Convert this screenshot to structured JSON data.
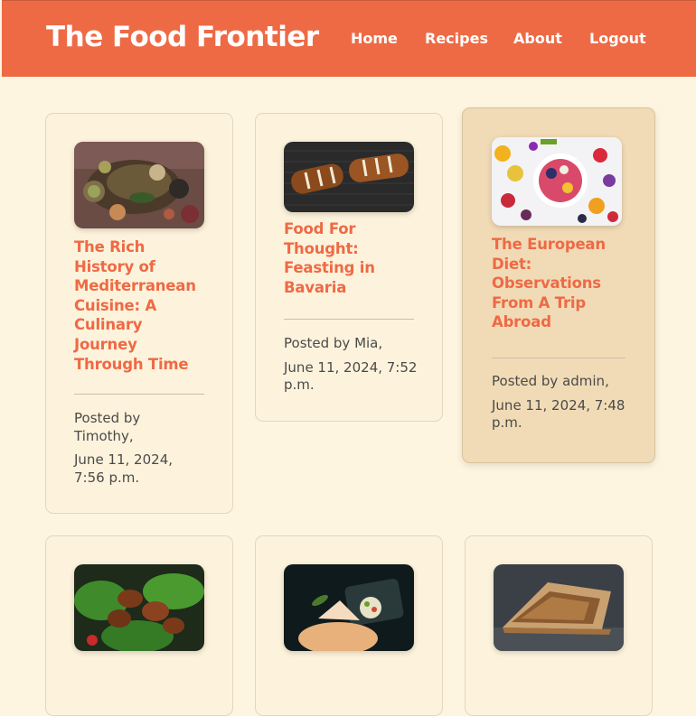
{
  "header": {
    "brand": "The Food Frontier",
    "nav": [
      {
        "label": "Home"
      },
      {
        "label": "Recipes"
      },
      {
        "label": "About"
      },
      {
        "label": "Logout"
      }
    ]
  },
  "posts": [
    {
      "title": "The Rich History of Mediterranean Cuisine: A Culinary Journey Through Time",
      "byline": "Posted by Timothy,",
      "date": "June 11, 2024, 7:56 p.m."
    },
    {
      "title": "Food For Thought: Feasting in Bavaria",
      "byline": "Posted by Mia,",
      "date": "June 11, 2024, 7:52 p.m."
    },
    {
      "title": "The European Diet: Observations From A Trip Abroad",
      "byline": "Posted by admin,",
      "date": "June 11, 2024, 7:48 p.m."
    },
    {
      "title": "",
      "byline": "",
      "date": ""
    },
    {
      "title": "",
      "byline": "",
      "date": ""
    },
    {
      "title": "",
      "byline": "",
      "date": ""
    }
  ],
  "colors": {
    "accent": "#ee6a45",
    "background": "#fdf5df",
    "card_hover": "#f1dbb6"
  }
}
